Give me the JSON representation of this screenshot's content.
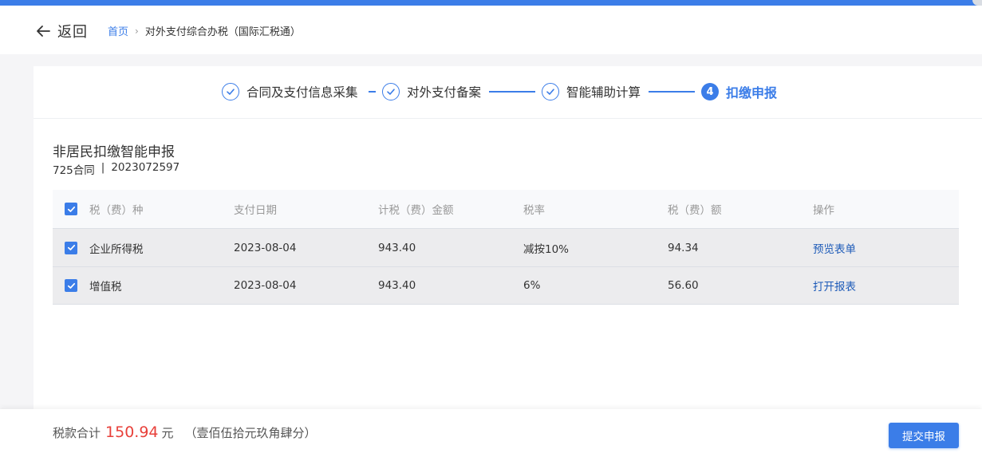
{
  "header": {
    "back_label": "返回",
    "breadcrumb": {
      "home": "首页",
      "separator": "›",
      "current": "对外支付综合办税（国际汇税通）"
    }
  },
  "steps": [
    {
      "label": "合同及支付信息采集",
      "status": "done"
    },
    {
      "label": "对外支付备案",
      "status": "done"
    },
    {
      "label": "智能辅助计算",
      "status": "done"
    },
    {
      "label": "扣缴申报",
      "status": "active",
      "number": "4"
    }
  ],
  "section": {
    "title": "非居民扣缴智能申报",
    "contract": "725合同",
    "divider": "|",
    "contract_no": "2023072597"
  },
  "table": {
    "columns": [
      "税（费）种",
      "支付日期",
      "计税（费）金额",
      "税率",
      "税（费）额",
      "操作"
    ],
    "rows": [
      {
        "type": "企业所得税",
        "date": "2023-08-04",
        "amount": "943.40",
        "rate": "减按10%",
        "tax": "94.34",
        "action": "预览表单",
        "checked": true
      },
      {
        "type": "增值税",
        "date": "2023-08-04",
        "amount": "943.40",
        "rate": "6%",
        "tax": "56.60",
        "action": "打开报表",
        "checked": true
      }
    ],
    "header_checked": true
  },
  "footer": {
    "total_label": "税款合计",
    "total_amount": "150.94",
    "unit": "元",
    "amount_in_words": "（壹佰伍拾元玖角肆分）",
    "submit_label": "提交申报"
  },
  "colors": {
    "accent": "#3b7de8",
    "amount": "#e8403a",
    "link": "#1e5bb8"
  }
}
